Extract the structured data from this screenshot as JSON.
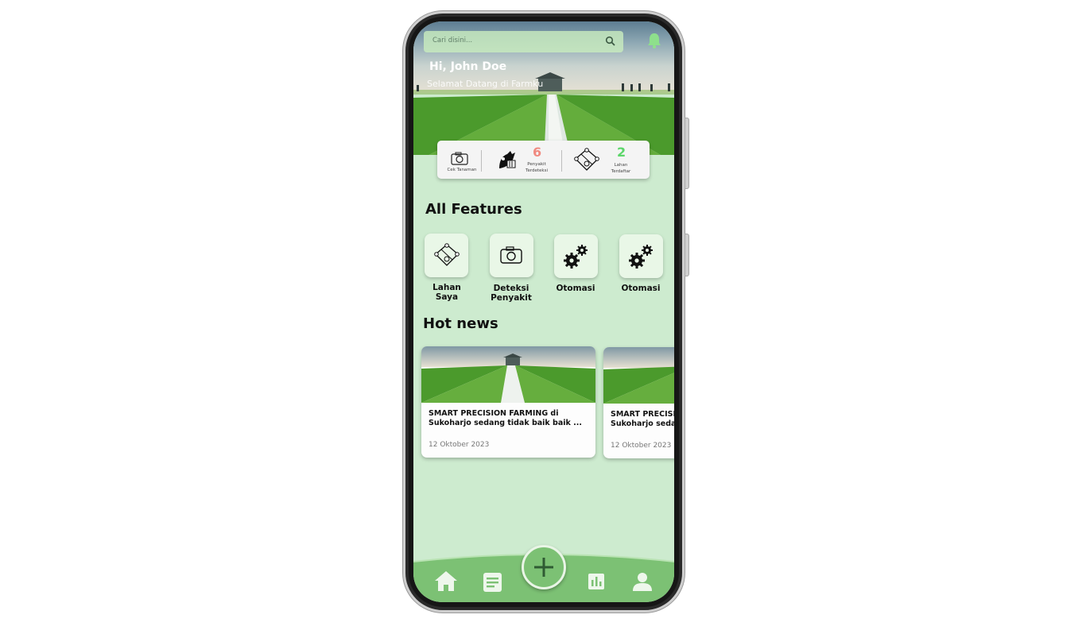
{
  "search": {
    "placeholder": "Cari disini..."
  },
  "header": {
    "greeting": "Hi, John Doe",
    "welcome": "Selamat Datang di Farmku"
  },
  "stats": {
    "scan_label": "Cek Tanaman",
    "disease_count": "6",
    "disease_label_1": "Penyakit",
    "disease_label_2": "Terdeteksi",
    "land_count": "2",
    "land_label_1": "Lahan",
    "land_label_2": "Terdaftar"
  },
  "features": {
    "title": "All Features",
    "items": [
      {
        "label_1": "Lahan",
        "label_2": "Saya",
        "icon": "land-map-icon"
      },
      {
        "label_1": "Deteksi",
        "label_2": "Penyakit",
        "icon": "camera-icon"
      },
      {
        "label_1": "Otomasi",
        "label_2": "",
        "icon": "gears-icon"
      },
      {
        "label_1": "Otomasi",
        "label_2": "",
        "icon": "gears-icon"
      }
    ]
  },
  "news": {
    "title": "Hot news",
    "items": [
      {
        "title_1": "SMART PRECISION FARMING di",
        "title_2": "Sukoharjo sedang tidak baik baik ...",
        "date": "12 Oktober 2023"
      },
      {
        "title_1": "SMART PRECISION FARMING di",
        "title_2": "Sukoharjo sedang tidak baik baik ...",
        "date": "12 Oktober 2023"
      }
    ]
  },
  "nav": {
    "items": [
      "home-icon",
      "document-icon",
      "add-icon",
      "chart-icon",
      "profile-icon"
    ]
  },
  "colors": {
    "background": "#cdebcf",
    "accent": "#7cc174",
    "disease_count": "#f08a80",
    "land_count": "#5cd66a"
  }
}
